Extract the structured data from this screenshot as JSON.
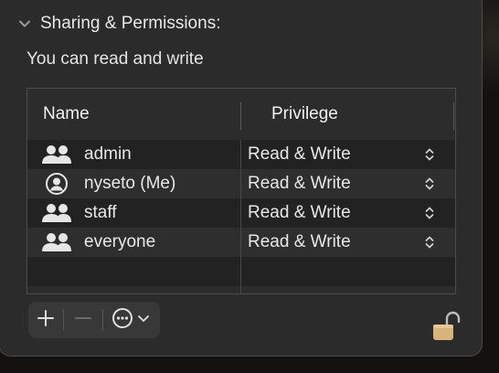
{
  "section": {
    "title": "Sharing & Permissions:",
    "icon": "chevron-down-icon"
  },
  "subtitle": "You can read and write",
  "table": {
    "columns": [
      "Name",
      "Privilege"
    ],
    "rows": [
      {
        "name": "admin",
        "icon": "group-icon",
        "privilege": "Read & Write"
      },
      {
        "name": "nyseto (Me)",
        "icon": "user-icon",
        "privilege": "Read & Write"
      },
      {
        "name": "staff",
        "icon": "group-icon",
        "privilege": "Read & Write"
      },
      {
        "name": "everyone",
        "icon": "group-icon",
        "privilege": "Read & Write"
      }
    ]
  },
  "toolbar": {
    "add_icon": "plus-icon",
    "remove_icon": "minus-icon",
    "more_icon": "ellipsis-circle-icon",
    "more_menu_icon": "chevron-down-icon"
  },
  "lock": {
    "icon": "unlocked-padlock-icon",
    "color": "#d8b47a"
  }
}
